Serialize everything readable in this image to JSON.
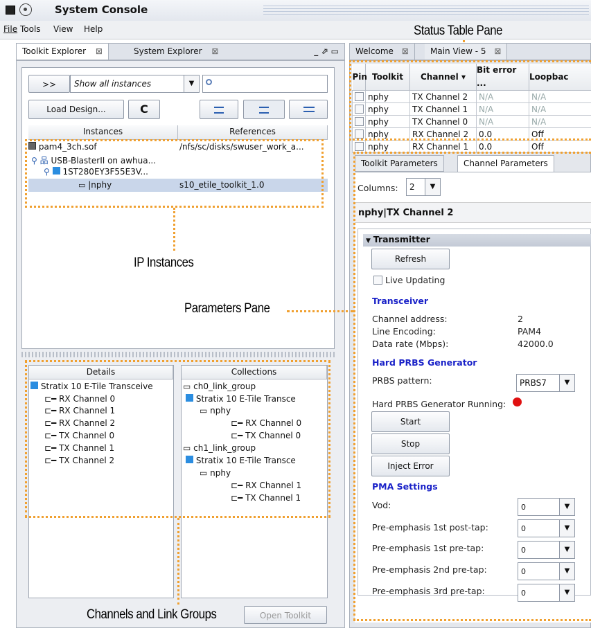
{
  "app": {
    "title": "System Console"
  },
  "menu": [
    "File",
    "Tools",
    "View",
    "Help"
  ],
  "callouts": {
    "status_table": "Status Table Pane",
    "ip_instances": "IP Instances",
    "parameters": "Parameters Pane",
    "channels": "Channels and  Link Groups"
  },
  "left_tabs": {
    "toolkit_explorer": "Toolkit Explorer",
    "system_explorer": "System Explorer",
    "close_glyph": "⊠",
    "window_ctrls": "_ ⬀ ▭"
  },
  "instances_toolbar": {
    "expand_label": ">>",
    "filter_value": "Show all instances",
    "search_placeholder": "",
    "load_design": "Load Design...",
    "refresh": "C"
  },
  "instances_table": {
    "headers": [
      "Instances",
      "References"
    ],
    "rows": [
      {
        "name": "pam4_3ch.sof",
        "ref": "/nfs/sc/disks/swuser_work_a..."
      },
      {
        "name": "USB-BlasterII on awhua...",
        "ref": ""
      },
      {
        "name": "1ST280EY3F55E3V...",
        "ref": ""
      },
      {
        "name": "|nphy",
        "ref": "s10_etile_toolkit_1.0"
      }
    ]
  },
  "details": {
    "header": "Details",
    "root": "Stratix 10 E-Tile Transceive",
    "items": [
      "RX Channel 0",
      "RX Channel 1",
      "RX Channel 2",
      "TX Channel 0",
      "TX Channel 1",
      "TX Channel 2"
    ]
  },
  "collections": {
    "header": "Collections",
    "groups": [
      {
        "name": "ch0_link_group",
        "device": "Stratix 10 E-Tile Transce",
        "ip": "nphy",
        "channels": [
          "RX Channel 0",
          "TX Channel 0"
        ]
      },
      {
        "name": "ch1_link_group",
        "device": "Stratix 10 E-Tile Transce",
        "ip": "nphy",
        "channels": [
          "RX Channel 1",
          "TX Channel 1"
        ]
      }
    ]
  },
  "open_toolkit": "Open Toolkit",
  "right_tabs": {
    "welcome": "Welcome",
    "main_view": "Main View - 5"
  },
  "status_table": {
    "headers": [
      "Pin",
      "Toolkit",
      "Channel ▾",
      "Bit error ...",
      "Loopbac"
    ],
    "rows": [
      [
        "",
        "nphy",
        "TX Channel 2",
        "N/A",
        "N/A"
      ],
      [
        "",
        "nphy",
        "TX Channel 1",
        "N/A",
        "N/A"
      ],
      [
        "",
        "nphy",
        "TX Channel 0",
        "N/A",
        "N/A"
      ],
      [
        "",
        "nphy",
        "RX Channel 2",
        "0.0",
        "Off"
      ],
      [
        "",
        "nphy",
        "RX Channel 1",
        "0.0",
        "Off"
      ]
    ]
  },
  "param_tabs": {
    "toolkit": "Toolkit Parameters",
    "channel": "Channel Parameters"
  },
  "columns": {
    "label": "Columns:",
    "value": "2"
  },
  "channel_title": "nphy|TX Channel 2",
  "transmitter": {
    "header": "Transmitter",
    "refresh": "Refresh",
    "live_updating": "Live Updating"
  },
  "transceiver": {
    "header": "Transceiver",
    "fields": [
      {
        "label": "Channel address:",
        "value": "2"
      },
      {
        "label": "Line Encoding:",
        "value": "PAM4"
      },
      {
        "label": "Data rate (Mbps):",
        "value": "42000.0"
      }
    ]
  },
  "prbs": {
    "header": "Hard PRBS Generator",
    "pattern_label": "PRBS pattern:",
    "pattern_value": "PRBS7",
    "running_label": "Hard PRBS Generator Running:",
    "running_color": "#e01010",
    "start": "Start",
    "stop": "Stop",
    "inject": "Inject Error"
  },
  "pma": {
    "header": "PMA Settings",
    "fields": [
      {
        "label": "Vod:",
        "value": "0"
      },
      {
        "label": "Pre-emphasis 1st post-tap:",
        "value": "0"
      },
      {
        "label": "Pre-emphasis 1st pre-tap:",
        "value": "0"
      },
      {
        "label": "Pre-emphasis 2nd pre-tap:",
        "value": "0"
      },
      {
        "label": "Pre-emphasis 3rd pre-tap:",
        "value": "0"
      }
    ]
  },
  "colors": {
    "accent": "#1a22c8",
    "callout": "#f0a030",
    "selection": "#c9d6ea"
  }
}
